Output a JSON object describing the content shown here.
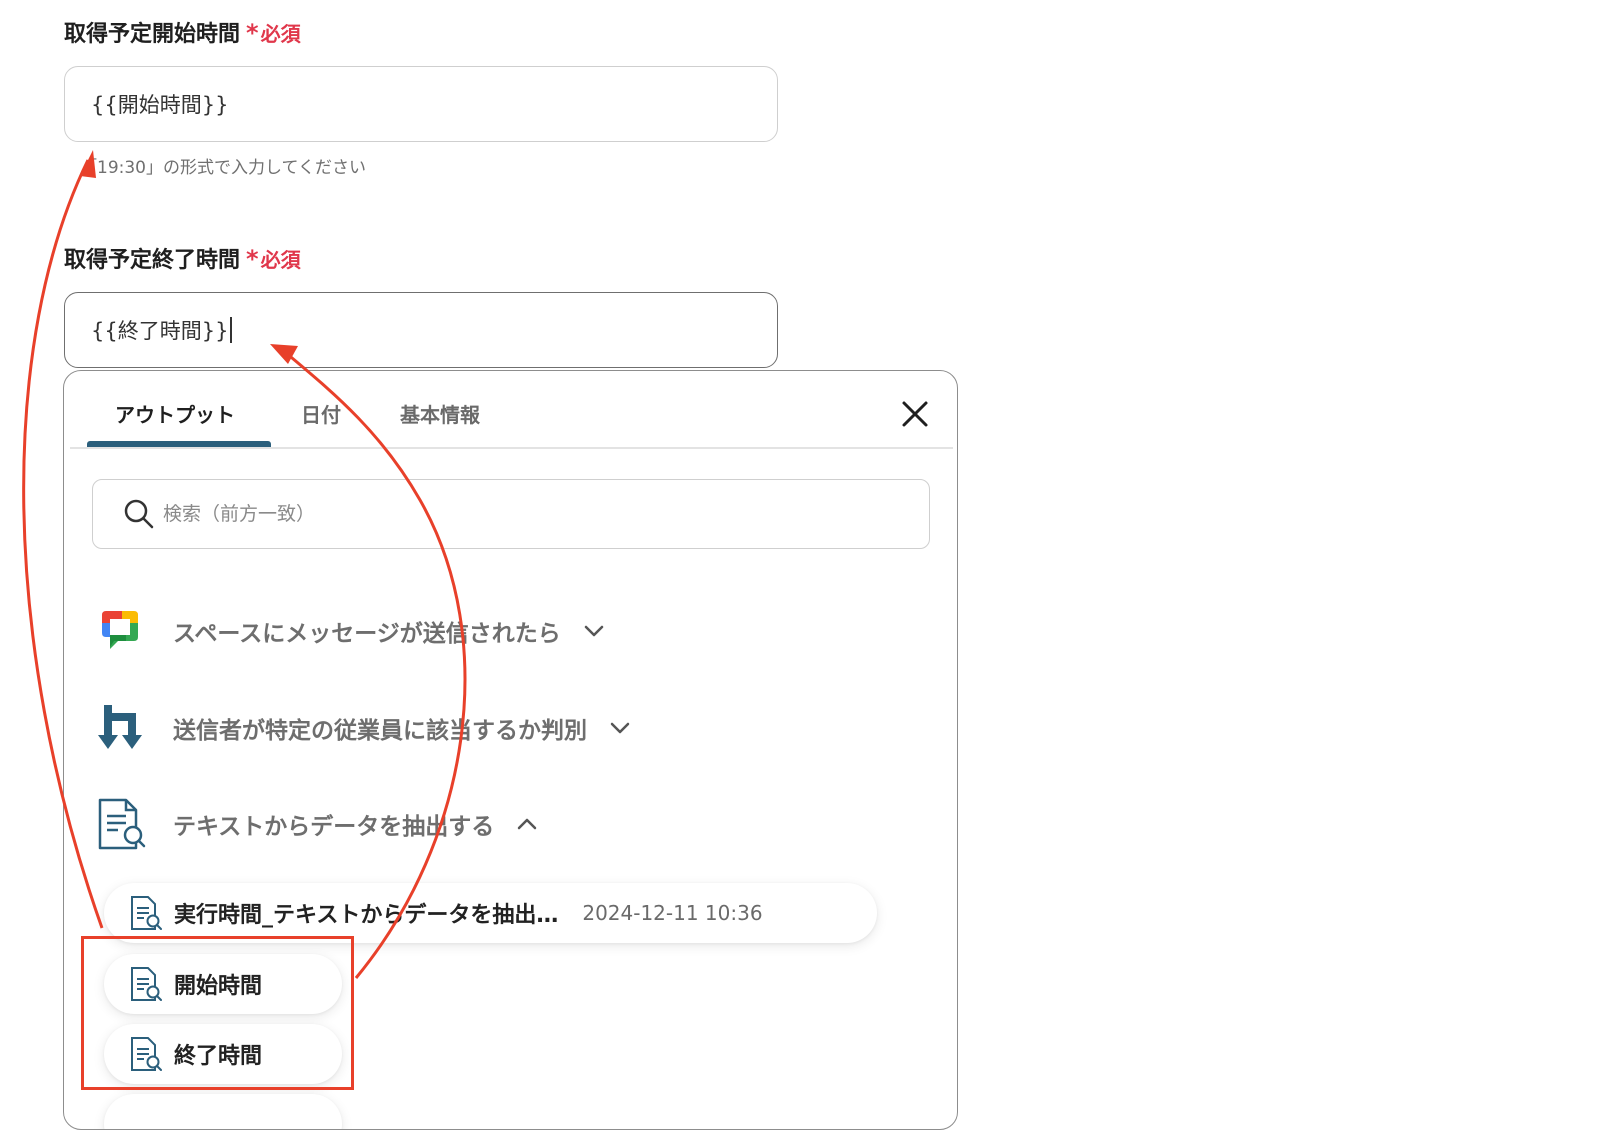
{
  "form": {
    "start_field": {
      "label": "取得予定開始時間",
      "required_star": "*",
      "required_text": "必須",
      "value": "{{開始時間}}",
      "hint": "「19:30」の形式で入力してください"
    },
    "end_field": {
      "label": "取得予定終了時間",
      "required_star": "*",
      "required_text": "必須",
      "value": "{{終了時間}}"
    }
  },
  "picker": {
    "tabs": [
      {
        "label": "アウトプット",
        "active": true
      },
      {
        "label": "日付",
        "active": false
      },
      {
        "label": "基本情報",
        "active": false
      }
    ],
    "close_icon": "close-icon",
    "search": {
      "placeholder": "検索（前方一致）",
      "icon": "search-icon"
    },
    "groups": [
      {
        "label": "スペースにメッセージが送信されたら",
        "icon": "google-chat-icon",
        "expanded": false
      },
      {
        "label": "送信者が特定の従業員に該当するか判別",
        "icon": "branch-icon",
        "expanded": false
      },
      {
        "label": "テキストからデータを抽出する",
        "icon": "extract-document-icon",
        "expanded": true
      }
    ],
    "items": [
      {
        "label": "実行時間_テキストからデータを抽出…",
        "value": "2024-12-11 10:36",
        "icon": "extract-document-icon"
      },
      {
        "label": "開始時間",
        "icon": "extract-document-icon"
      },
      {
        "label": "終了時間",
        "icon": "extract-document-icon"
      }
    ]
  },
  "colors": {
    "required": "#e0374b",
    "active_tab": "#2b5f7c",
    "annotation": "#e8402a"
  }
}
